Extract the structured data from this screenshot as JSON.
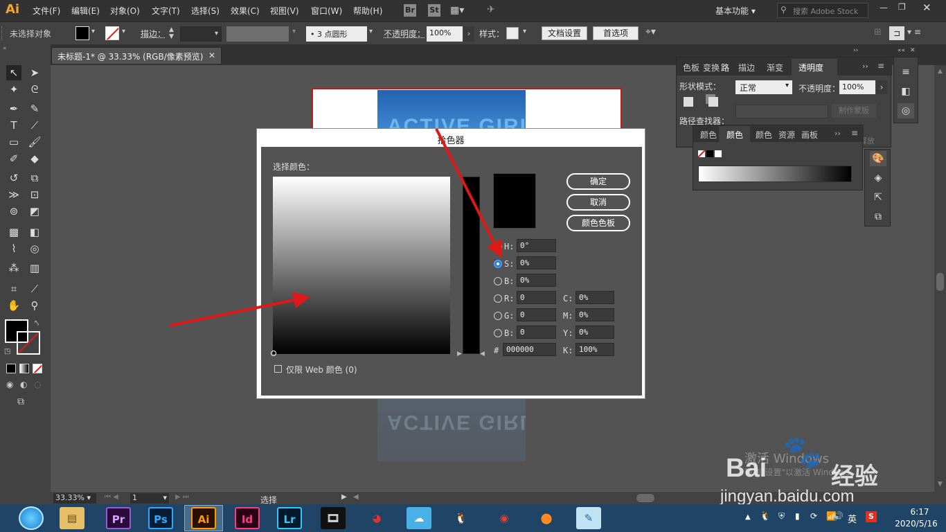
{
  "menubar": {
    "logo": "Ai",
    "menus": [
      "文件(F)",
      "编辑(E)",
      "对象(O)",
      "文字(T)",
      "选择(S)",
      "效果(C)",
      "视图(V)",
      "窗口(W)",
      "帮助(H)"
    ],
    "br": "Br",
    "st": "St",
    "workspace": "基本功能",
    "search_placeholder": "搜索 Adobe Stock"
  },
  "controlbar": {
    "no_selection": "未选择对象",
    "stroke_label": "描边：",
    "brush_value": "3 点圆形",
    "opacity_label": "不透明度：",
    "opacity_value": "100%",
    "style_label": "样式：",
    "doc_settings": "文档设置",
    "preferences": "首选项"
  },
  "document": {
    "tab_title": "未标题-1* @ 33.33% (RGB/像素预览)",
    "artwork_text": "ACTIVE GIRL",
    "artwork_reflection": "ACTIVE GIRL"
  },
  "statusbar": {
    "zoom": "33.33%",
    "page": "1",
    "tool": "选择"
  },
  "color_picker": {
    "title": "拾色器",
    "select_color_label": "选择颜色：",
    "ok": "确定",
    "cancel": "取消",
    "swatches": "颜色色板",
    "h_label": "H:",
    "h_value": "0°",
    "s_label": "S:",
    "s_value": "0%",
    "b_label": "B:",
    "b_value": "0%",
    "r_label": "R:",
    "r_value": "0",
    "g_label": "G:",
    "g_value": "0",
    "b2_label": "B:",
    "b2_value": "0",
    "hex_label": "#",
    "hex_value": "000000",
    "c_label": "C:",
    "c_value": "0%",
    "m_label": "M:",
    "m_value": "0%",
    "y_label": "Y:",
    "y_value": "0%",
    "k_label": "K:",
    "k_value": "100%",
    "web_only": "仅限 Web 颜色 (0)",
    "selected_radio": "S"
  },
  "panels": {
    "top_tabs": [
      "色板",
      "变换",
      "路",
      "描边",
      "渐变",
      "透明度"
    ],
    "shape_modes": "形状模式：",
    "pathfinder": "路径查找器：",
    "blend_mode": "正常",
    "opacity_label": "不透明度：",
    "opacity_value": "100%",
    "make_mask": "制作蒙版",
    "release": "释放",
    "color_tabs": [
      "颜色",
      "颜色",
      "颜色",
      "资源",
      "画板"
    ]
  },
  "taskbar": {
    "apps": [
      "Pr",
      "Ps",
      "Ai",
      "Id",
      "Lr"
    ],
    "ime": "英",
    "time": "6:17",
    "date": "2020/5/16"
  },
  "watermark": {
    "activate": "激活 Windows",
    "activate_sub": "转到\"设置\"以激活 Windows。",
    "baidu": "Bai",
    "baidu2": "经验",
    "url": "jingyan.baidu.com"
  },
  "colors": {
    "accent_red": "#e01818",
    "radio_blue": "#2e7de0",
    "artwork_blue": "#2a6cb8"
  }
}
